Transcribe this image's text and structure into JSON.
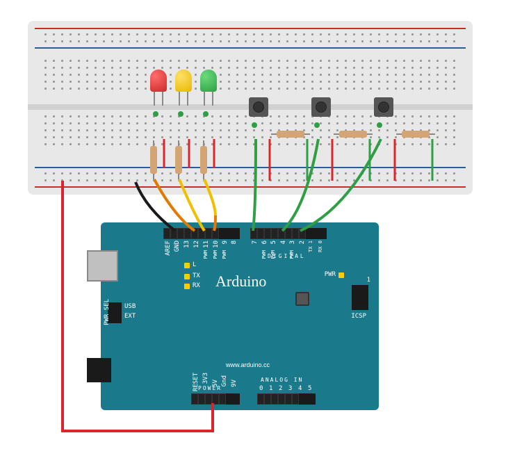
{
  "domain": "Diagram",
  "description": "Fritzing-style wiring diagram: Arduino Uno connected to a breadboard with three LEDs (red, yellow, green), three tactile pushbuttons, and associated resistors.",
  "breadboard": {
    "type": "full-size",
    "rails": [
      "+",
      "-",
      "+",
      "-"
    ],
    "components": {
      "leds": [
        {
          "color": "red",
          "columns_approx": "f-g row ~15",
          "orientation": "vertical"
        },
        {
          "color": "yellow",
          "columns_approx": "f-g row ~18",
          "orientation": "vertical"
        },
        {
          "color": "green",
          "columns_approx": "f-g row ~21",
          "orientation": "vertical"
        }
      ],
      "buttons": [
        {
          "index": 1,
          "span": "rows e-f, cols ~28-30"
        },
        {
          "index": 2,
          "span": "rows e-f, cols ~35-37"
        },
        {
          "index": 3,
          "span": "rows e-f, cols ~42-44"
        }
      ],
      "resistors": [
        {
          "for": "led-red",
          "orientation": "vertical",
          "approx_col": 15
        },
        {
          "for": "led-yellow",
          "orientation": "vertical",
          "approx_col": 18
        },
        {
          "for": "led-green",
          "orientation": "vertical",
          "approx_col": 21
        },
        {
          "for": "button-1",
          "orientation": "horizontal",
          "approx_cols": "30-33"
        },
        {
          "for": "button-2",
          "orientation": "horizontal",
          "approx_cols": "37-40"
        },
        {
          "for": "button-3",
          "orientation": "horizontal",
          "approx_cols": "44-47"
        }
      ]
    }
  },
  "arduino": {
    "board": "Arduino",
    "brand_text": "Arduino",
    "url_text": "www.arduino.cc",
    "indicator_labels": {
      "l": "L",
      "tx": "TX",
      "rx": "RX",
      "pwr": "PWR"
    },
    "pwr_sel": {
      "label": "PWR SEL",
      "opt_usb": "USB",
      "opt_ext": "EXT"
    },
    "icsp_labels": {
      "title": "ICSP",
      "pin1": "1"
    },
    "headers": {
      "digital_left": {
        "group": "",
        "pins": [
          "AREF",
          "GND",
          "13",
          "12",
          "11",
          "10",
          "9",
          "8"
        ],
        "pwm_flags": [
          false,
          false,
          false,
          false,
          true,
          true,
          true,
          false
        ]
      },
      "digital_right": {
        "group": "DIGITAL",
        "pins": [
          "7",
          "6",
          "5",
          "4",
          "3",
          "2",
          "TX 1",
          "RX 0"
        ],
        "pwm_flags": [
          false,
          true,
          true,
          false,
          true,
          false,
          false,
          false
        ]
      },
      "power": {
        "group": "POWER",
        "pins": [
          "RESET",
          "3V3",
          "5V",
          "Gnd",
          "9V"
        ]
      },
      "analog": {
        "group": "ANALOG IN",
        "pins": [
          "0",
          "1",
          "2",
          "3",
          "4",
          "5"
        ]
      }
    },
    "pwm_label": "PWM"
  },
  "wires": [
    {
      "color": "red",
      "from": "Arduino 5V",
      "to": "breadboard bottom + rail (left)"
    },
    {
      "color": "black",
      "from": "Arduino GND (digital side)",
      "to": "breadboard bottom - rail"
    },
    {
      "color": "orange",
      "from": "red LED resistor",
      "to": "Arduino D12"
    },
    {
      "color": "yellow",
      "from": "yellow LED resistor",
      "to": "Arduino D11"
    },
    {
      "color": "orange",
      "from": "green LED resistor (via jumper)",
      "to": "Arduino D10"
    },
    {
      "color": "red",
      "from": "LED cathodes bus",
      "to": "- rail (short jumpers x3 approx)"
    },
    {
      "color": "green",
      "from": "button 1",
      "to": "Arduino D7"
    },
    {
      "color": "green",
      "from": "button 2",
      "to": "Arduino D4"
    },
    {
      "color": "green",
      "from": "button 3",
      "to": "Arduino D2"
    },
    {
      "color": "red",
      "from": "button 1 other leg",
      "to": "- rail jumper"
    },
    {
      "color": "red",
      "from": "button 2 other leg",
      "to": "- rail jumper"
    },
    {
      "color": "red",
      "from": "button 3 other leg",
      "to": "- rail jumper"
    },
    {
      "color": "green",
      "from": "button pulldown resistors far leg",
      "to": "+ rail jumpers"
    }
  ],
  "colors": {
    "wire_red": "#d9262c",
    "wire_green": "#2f9e44",
    "wire_yellow": "#f0c000",
    "wire_orange": "#e07b00",
    "wire_black": "#1a1a1a",
    "arduino_teal": "#1a7a8c",
    "breadboard_grey": "#e8e8e8"
  }
}
